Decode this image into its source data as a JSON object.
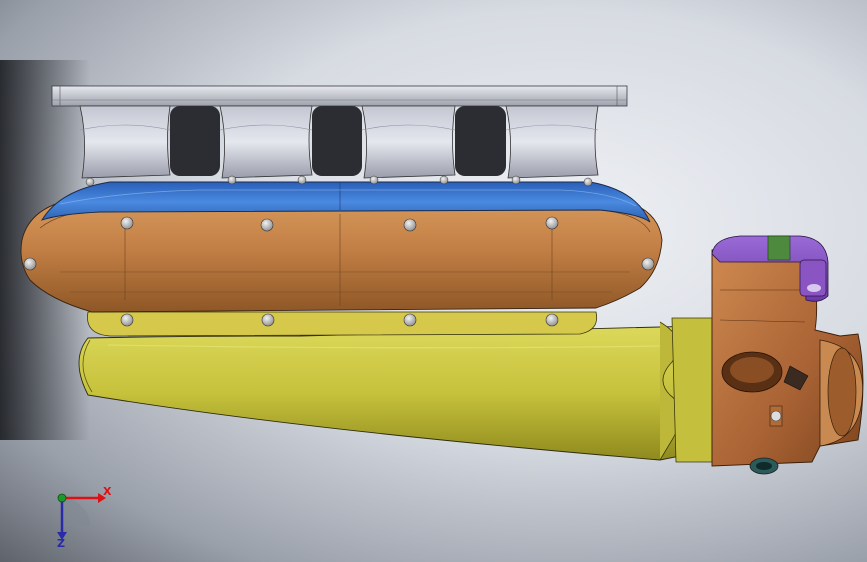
{
  "viewport": {
    "background": "#d9dde3"
  },
  "model": {
    "parts": [
      {
        "name": "flange-plate",
        "color": "#c9cbd3"
      },
      {
        "name": "runners",
        "color": "#b9bcc8"
      },
      {
        "name": "plenum-top",
        "color": "#3e7cd6"
      },
      {
        "name": "plenum-body",
        "color": "#c7874c"
      },
      {
        "name": "plenum-gasket",
        "color": "#d8c04a"
      },
      {
        "name": "inlet-tube",
        "color": "#c8c43f"
      },
      {
        "name": "throttle-body",
        "color": "#b47040"
      },
      {
        "name": "tps-sensor",
        "color": "#8a55c2"
      }
    ]
  },
  "triad": {
    "x_label": "X",
    "z_label": "Z",
    "x_color": "#d11",
    "y_color": "#1a9a2a",
    "z_color": "#2a2aa8"
  }
}
